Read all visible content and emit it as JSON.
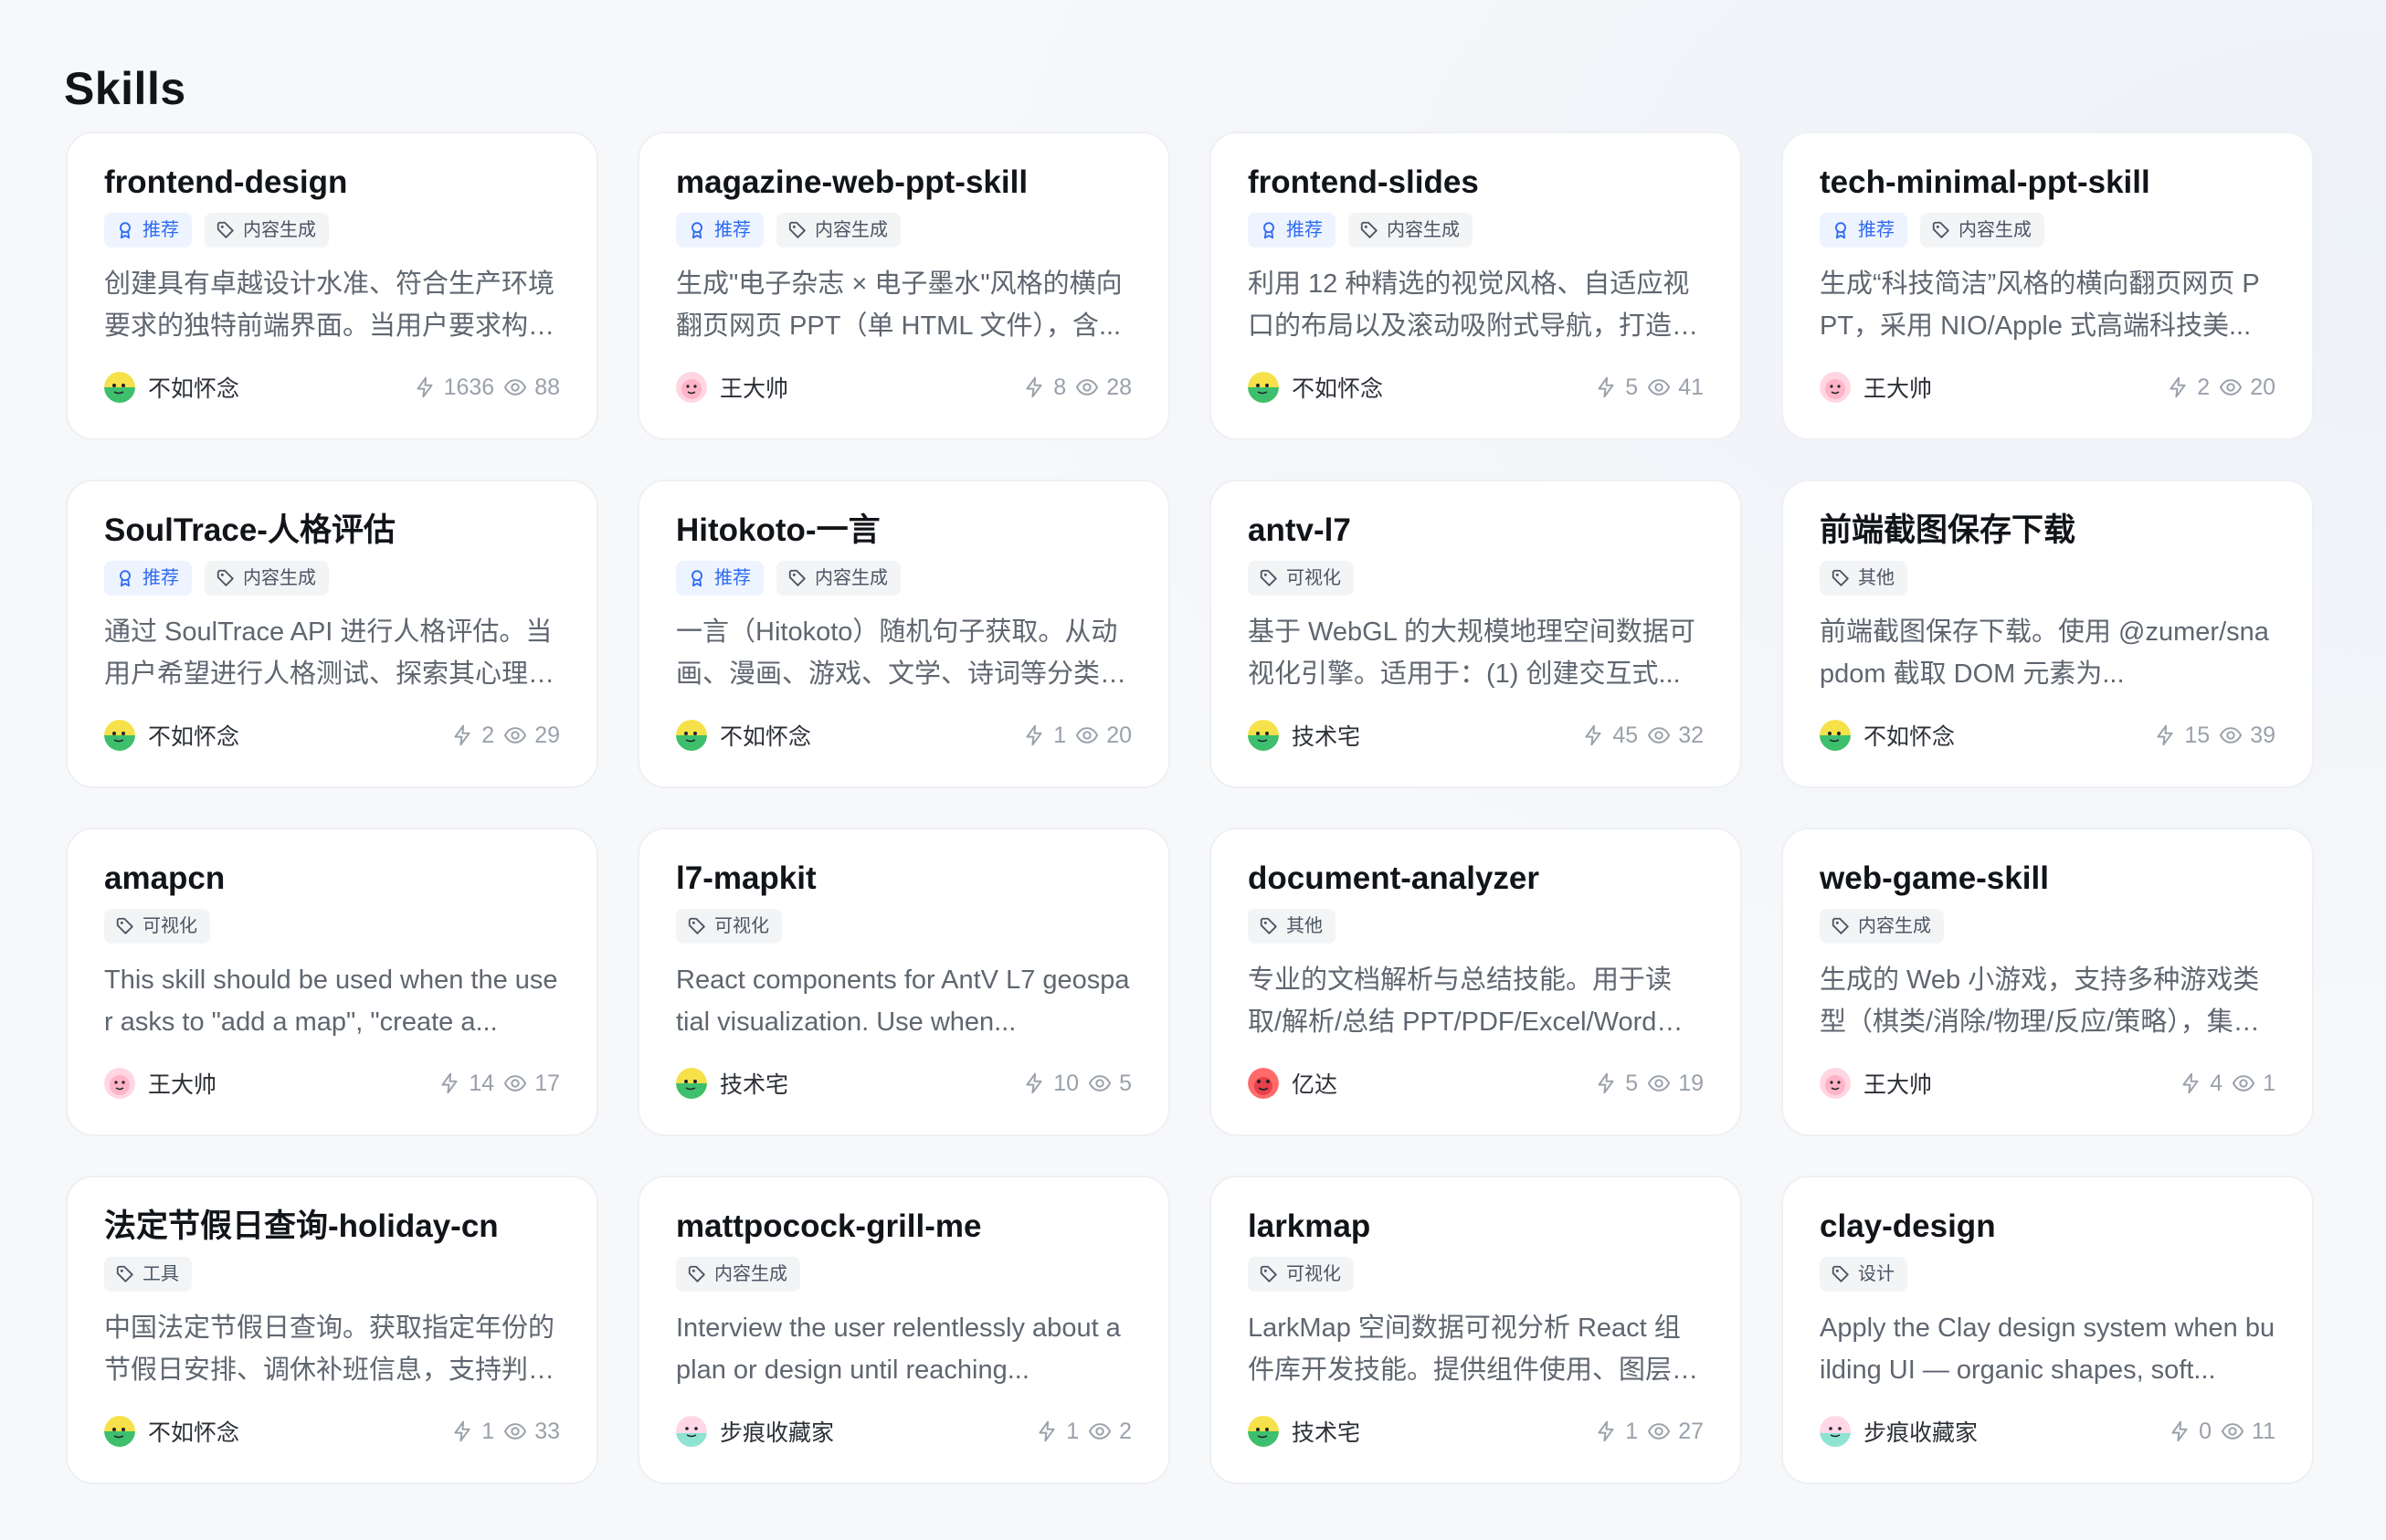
{
  "page": {
    "title": "Skills"
  },
  "tags": {
    "recommended": "推荐"
  },
  "cards": [
    {
      "title": "frontend-design",
      "recommended": true,
      "category": "内容生成",
      "desc": "创建具有卓越设计水准、符合生产环境要求的独特前端界面。当用户要求构建...",
      "author": "不如怀念",
      "avatar": "green",
      "uses": "1636",
      "views": "88"
    },
    {
      "title": "magazine-web-ppt-skill",
      "recommended": true,
      "category": "内容生成",
      "desc": "生成\"电子杂志 × 电子墨水\"风格的横向翻页网页 PPT（单 HTML 文件），含...",
      "author": "王大帅",
      "avatar": "pink",
      "uses": "8",
      "views": "28"
    },
    {
      "title": "frontend-slides",
      "recommended": true,
      "category": "内容生成",
      "desc": "利用 12 种精选的视觉风格、自适应视口的布局以及滚动吸附式导航，打造令人...",
      "author": "不如怀念",
      "avatar": "green",
      "uses": "5",
      "views": "41"
    },
    {
      "title": "tech-minimal-ppt-skill",
      "recommended": true,
      "category": "内容生成",
      "desc": "生成“科技简洁”风格的横向翻页网页 PPT，采用 NIO/Apple 式高端科技美...",
      "author": "王大帅",
      "avatar": "pink",
      "uses": "2",
      "views": "20"
    },
    {
      "title": "SoulTrace-人格评估",
      "recommended": true,
      "category": "内容生成",
      "desc": "通过 SoulTrace API 进行人格评估。当用户希望进行人格测试、探索其心理原...",
      "author": "不如怀念",
      "avatar": "green",
      "uses": "2",
      "views": "29"
    },
    {
      "title": "Hitokoto-一言",
      "recommended": true,
      "category": "内容生成",
      "desc": "一言（Hitokoto）随机句子获取。从动画、漫画、游戏、文学、诗词等分类中...",
      "author": "不如怀念",
      "avatar": "green",
      "uses": "1",
      "views": "20"
    },
    {
      "title": "antv-l7",
      "recommended": false,
      "category": "可视化",
      "desc": "基于 WebGL 的大规模地理空间数据可视化引擎。适用于：(1) 创建交互式...",
      "author": "技术宅",
      "avatar": "green",
      "uses": "45",
      "views": "32"
    },
    {
      "title": "前端截图保存下载",
      "recommended": false,
      "category": "其他",
      "desc": "前端截图保存下载。使用 @zumer/snapdom 截取 DOM 元素为...",
      "author": "不如怀念",
      "avatar": "green",
      "uses": "15",
      "views": "39"
    },
    {
      "title": "amapcn",
      "recommended": false,
      "category": "可视化",
      "desc": "This skill should be used when the user asks to \"add a map\", \"create a...",
      "author": "王大帅",
      "avatar": "pink",
      "uses": "14",
      "views": "17"
    },
    {
      "title": "l7-mapkit",
      "recommended": false,
      "category": "可视化",
      "desc": "React components for AntV L7 geospatial visualization. Use when...",
      "author": "技术宅",
      "avatar": "green",
      "uses": "10",
      "views": "5"
    },
    {
      "title": "document-analyzer",
      "recommended": false,
      "category": "其他",
      "desc": "专业的文档解析与总结技能。用于读取/解析/总结 PPT/PDF/Excel/Word 文...",
      "author": "亿达",
      "avatar": "red",
      "uses": "5",
      "views": "19"
    },
    {
      "title": "web-game-skill",
      "recommended": false,
      "category": "内容生成",
      "desc": "生成的 Web 小游戏，支持多种游戏类型（棋类/消除/物理/反应/策略），集成...",
      "author": "王大帅",
      "avatar": "pink",
      "uses": "4",
      "views": "1"
    },
    {
      "title": "法定节假日查询-holiday-cn",
      "recommended": false,
      "category": "工具",
      "desc": "中国法定节假日查询。获取指定年份的节假日安排、调休补班信息，支持判断...",
      "author": "不如怀念",
      "avatar": "green",
      "uses": "1",
      "views": "33"
    },
    {
      "title": "mattpocock-grill-me",
      "recommended": false,
      "category": "内容生成",
      "desc": "Interview the user relentlessly about a plan or design until reaching...",
      "author": "步痕收藏家",
      "avatar": "teal",
      "uses": "1",
      "views": "2"
    },
    {
      "title": "larkmap",
      "recommended": false,
      "category": "可视化",
      "desc": "LarkMap 空间数据可视分析 React 组件库开发技能。提供组件使用、图层配...",
      "author": "技术宅",
      "avatar": "green",
      "uses": "1",
      "views": "27"
    },
    {
      "title": "clay-design",
      "recommended": false,
      "category": "设计",
      "desc": "Apply the Clay design system when building UI — organic shapes, soft...",
      "author": "步痕收藏家",
      "avatar": "teal",
      "uses": "0",
      "views": "11"
    }
  ]
}
